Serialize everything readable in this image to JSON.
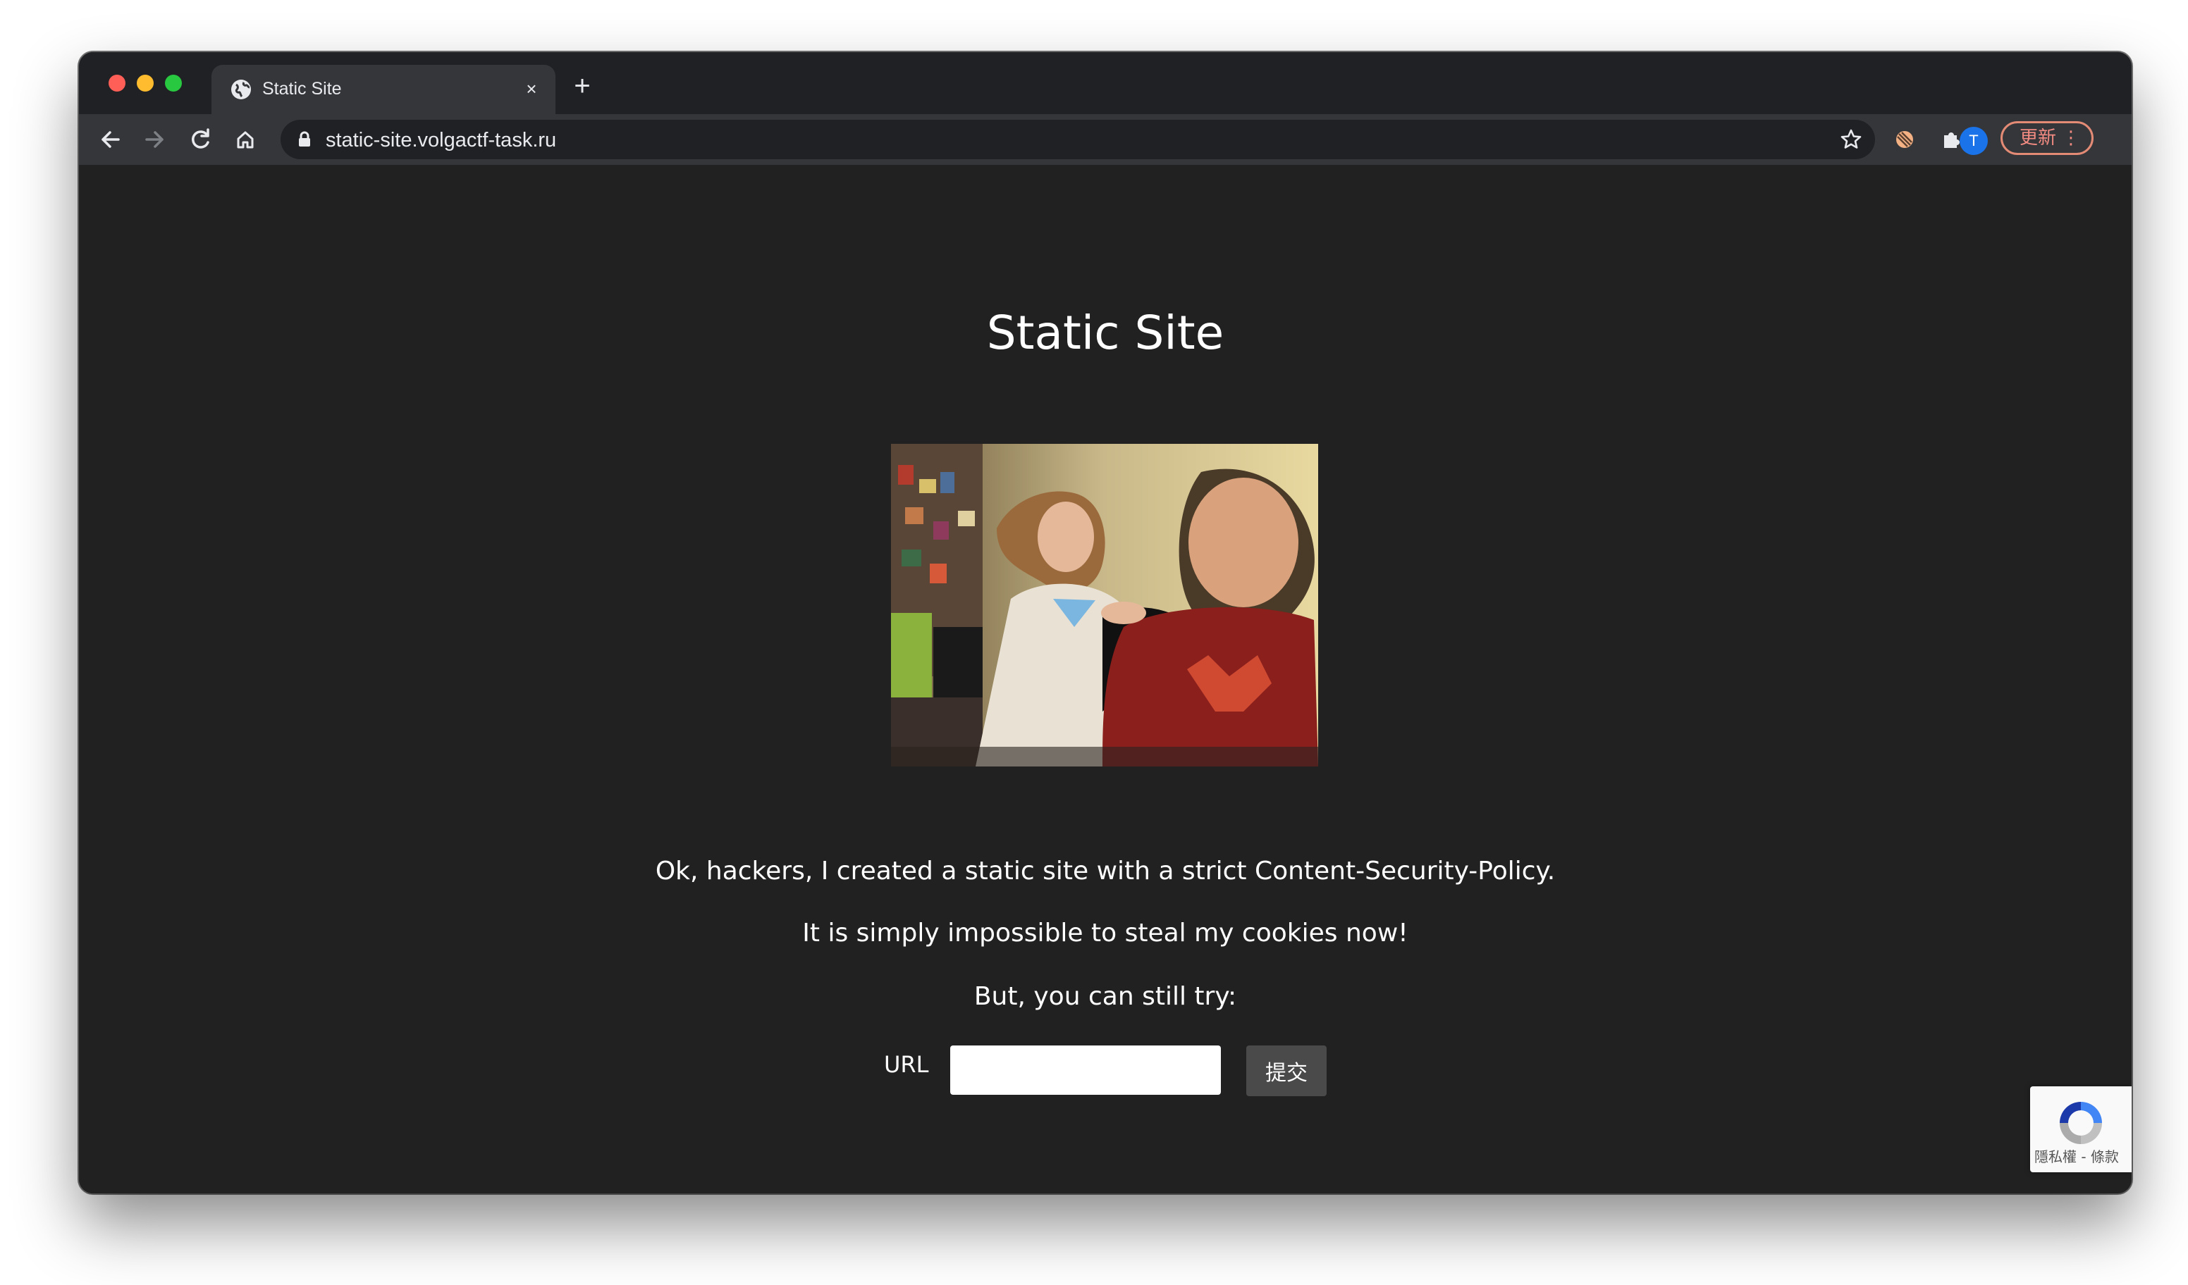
{
  "browser": {
    "tab": {
      "title": "Static Site",
      "close_glyph": "×"
    },
    "new_tab_glyph": "+",
    "address_bar": {
      "url": "static-site.volgactf-task.ru"
    },
    "profile_initial": "T",
    "update_button_label": "更新",
    "menu_glyph": "⋮"
  },
  "page": {
    "title": "Static Site",
    "paragraphs": [
      "Ok, hackers, I created a static site with a strict Content-Security-Policy.",
      "It is simply impossible to steal my cookies now!",
      "But, you can still try:"
    ],
    "form": {
      "url_label": "URL",
      "url_value": "",
      "submit_label": "提交"
    }
  },
  "recaptcha": {
    "links_text": "隱私權 - 條款"
  },
  "colors": {
    "page_background": "#212121",
    "toolbar": "#35363a",
    "tabstrip": "#202124",
    "update_accent": "#f28b82",
    "avatar": "#1a73e8"
  },
  "icons": {
    "tab_favicon": "globe-icon",
    "back": "arrow-left-icon",
    "forward": "arrow-right-icon",
    "reload": "reload-icon",
    "home": "home-icon",
    "secure": "lock-icon",
    "bookmark": "star-icon",
    "extension_1": "extension-icon",
    "extensions": "puzzle-icon"
  }
}
